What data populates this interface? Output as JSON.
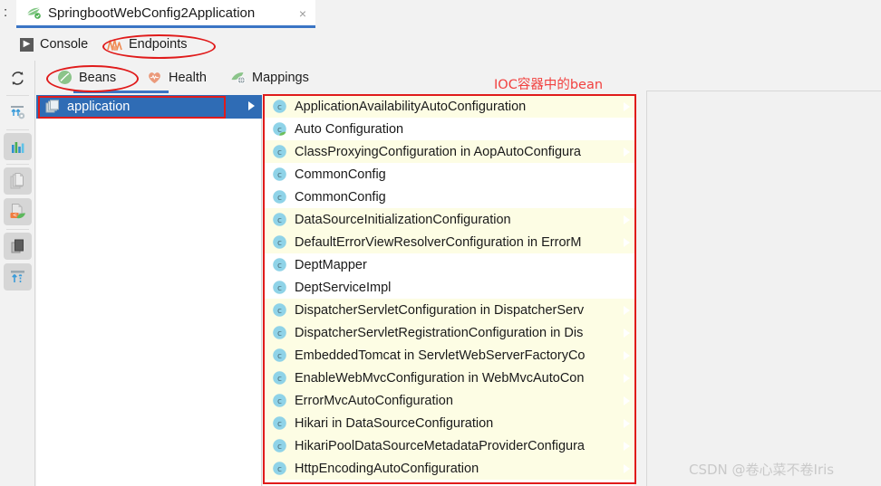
{
  "window": {
    "prefix": ":",
    "run_tab": {
      "title": "SpringbootWebConfig2Application",
      "icon": "spring-leaf-run-icon",
      "close_label": "×"
    }
  },
  "subtabs": [
    {
      "label": "Console",
      "icon": "console-icon",
      "selected": false
    },
    {
      "label": "Endpoints",
      "icon": "endpoints-chart-icon",
      "selected": true
    }
  ],
  "endpoint_tabs": [
    {
      "label": "Beans",
      "icon": "beans-leaf-icon",
      "selected": true
    },
    {
      "label": "Health",
      "icon": "health-heart-icon",
      "selected": false
    },
    {
      "label": "Mappings",
      "icon": "mappings-globe-icon",
      "selected": false
    }
  ],
  "left_toolbar": [
    {
      "name": "refresh-icon",
      "selected": false
    },
    {
      "name": "expand-collapse-icon",
      "selected": false
    },
    {
      "name": "bar-chart-icon",
      "selected": true
    },
    {
      "name": "copy-pages-icon",
      "selected": true
    },
    {
      "name": "export-spring-icon",
      "selected": true
    },
    {
      "name": "copy-dark-icon",
      "selected": true
    },
    {
      "name": "expand-all-icon",
      "selected": true
    }
  ],
  "tree": {
    "selected_node": {
      "label": "application",
      "icon": "module-icon",
      "expand_arrow": "chevron-right-icon"
    }
  },
  "beans": [
    "ApplicationAvailabilityAutoConfiguration",
    "Auto Configuration",
    "ClassProxyingConfiguration in AopAutoConfigura",
    "CommonConfig",
    "CommonConfig",
    "DataSourceInitializationConfiguration",
    "DefaultErrorViewResolverConfiguration in ErrorM",
    "DeptMapper",
    "DeptServiceImpl",
    "DispatcherServletConfiguration in DispatcherServ",
    "DispatcherServletRegistrationConfiguration in Dis",
    "EmbeddedTomcat in ServletWebServerFactoryCo",
    "EnableWebMvcConfiguration in WebMvcAutoCon",
    "ErrorMvcAutoConfiguration",
    "Hikari in DataSourceConfiguration",
    "HikariPoolDataSourceMetadataProviderConfigura",
    "HttpEncodingAutoConfiguration"
  ],
  "bean_row_highlight": [
    true,
    false,
    true,
    false,
    false,
    true,
    true,
    false,
    false,
    true,
    true,
    true,
    true,
    true,
    true,
    true,
    true
  ],
  "bean_row_arrow": [
    true,
    false,
    true,
    false,
    false,
    true,
    true,
    false,
    false,
    true,
    true,
    true,
    true,
    true,
    true,
    true,
    true
  ],
  "bean_icon_name": "class-bean-icon",
  "bean_icon_letter": "c",
  "annotations": {
    "label_ioc": "IOC容器中的bean",
    "accent_color": "#e01b1b"
  },
  "watermark": "CSDN @卷心菜不卷Iris"
}
